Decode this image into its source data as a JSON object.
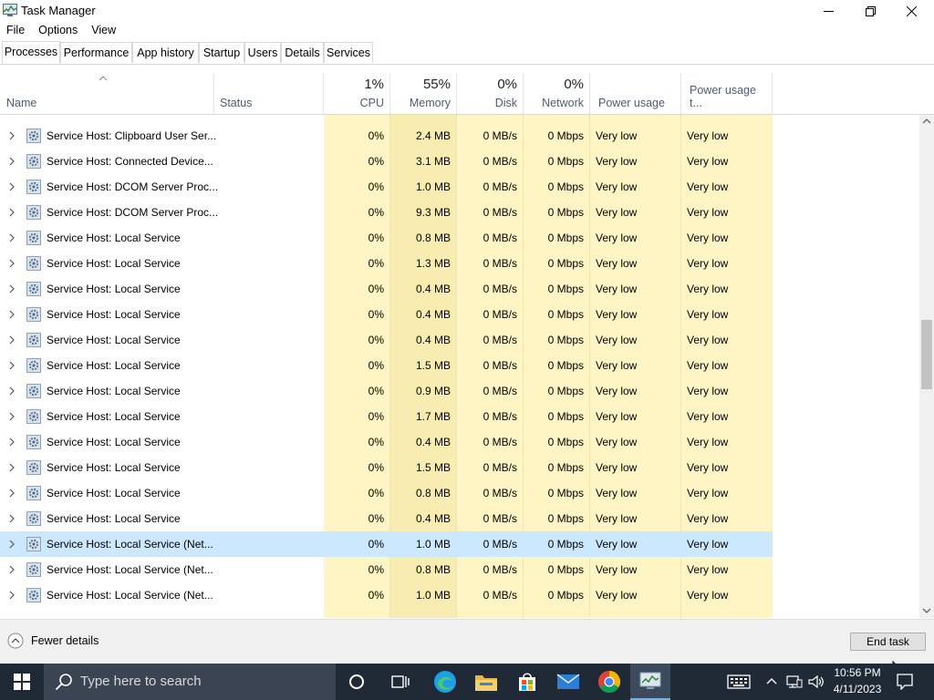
{
  "window": {
    "title": "Task Manager"
  },
  "menu": [
    "File",
    "Options",
    "View"
  ],
  "tabs": [
    "Processes",
    "Performance",
    "App history",
    "Startup",
    "Users",
    "Details",
    "Services"
  ],
  "active_tab": "Processes",
  "columns": {
    "name": {
      "label": "Name"
    },
    "status": {
      "label": "Status"
    },
    "cpu": {
      "pct": "1%",
      "label": "CPU"
    },
    "memory": {
      "pct": "55%",
      "label": "Memory"
    },
    "disk": {
      "pct": "0%",
      "label": "Disk"
    },
    "network": {
      "pct": "0%",
      "label": "Network"
    },
    "power": {
      "label": "Power usage"
    },
    "power_trend": {
      "label": "Power usage t..."
    }
  },
  "rows": [
    {
      "name": "Service Host: Clipboard User Ser...",
      "cpu": "0%",
      "memory": "2.4 MB",
      "disk": "0 MB/s",
      "network": "0 Mbps",
      "power": "Very low",
      "power_trend": "Very low"
    },
    {
      "name": "Service Host: Connected Device...",
      "cpu": "0%",
      "memory": "3.1 MB",
      "disk": "0 MB/s",
      "network": "0 Mbps",
      "power": "Very low",
      "power_trend": "Very low"
    },
    {
      "name": "Service Host: DCOM Server Proc...",
      "cpu": "0%",
      "memory": "1.0 MB",
      "disk": "0 MB/s",
      "network": "0 Mbps",
      "power": "Very low",
      "power_trend": "Very low"
    },
    {
      "name": "Service Host: DCOM Server Proc...",
      "cpu": "0%",
      "memory": "9.3 MB",
      "disk": "0 MB/s",
      "network": "0 Mbps",
      "power": "Very low",
      "power_trend": "Very low"
    },
    {
      "name": "Service Host: Local Service",
      "cpu": "0%",
      "memory": "0.8 MB",
      "disk": "0 MB/s",
      "network": "0 Mbps",
      "power": "Very low",
      "power_trend": "Very low"
    },
    {
      "name": "Service Host: Local Service",
      "cpu": "0%",
      "memory": "1.3 MB",
      "disk": "0 MB/s",
      "network": "0 Mbps",
      "power": "Very low",
      "power_trend": "Very low"
    },
    {
      "name": "Service Host: Local Service",
      "cpu": "0%",
      "memory": "0.4 MB",
      "disk": "0 MB/s",
      "network": "0 Mbps",
      "power": "Very low",
      "power_trend": "Very low"
    },
    {
      "name": "Service Host: Local Service",
      "cpu": "0%",
      "memory": "0.4 MB",
      "disk": "0 MB/s",
      "network": "0 Mbps",
      "power": "Very low",
      "power_trend": "Very low"
    },
    {
      "name": "Service Host: Local Service",
      "cpu": "0%",
      "memory": "0.4 MB",
      "disk": "0 MB/s",
      "network": "0 Mbps",
      "power": "Very low",
      "power_trend": "Very low"
    },
    {
      "name": "Service Host: Local Service",
      "cpu": "0%",
      "memory": "1.5 MB",
      "disk": "0 MB/s",
      "network": "0 Mbps",
      "power": "Very low",
      "power_trend": "Very low"
    },
    {
      "name": "Service Host: Local Service",
      "cpu": "0%",
      "memory": "0.9 MB",
      "disk": "0 MB/s",
      "network": "0 Mbps",
      "power": "Very low",
      "power_trend": "Very low"
    },
    {
      "name": "Service Host: Local Service",
      "cpu": "0%",
      "memory": "1.7 MB",
      "disk": "0 MB/s",
      "network": "0 Mbps",
      "power": "Very low",
      "power_trend": "Very low"
    },
    {
      "name": "Service Host: Local Service",
      "cpu": "0%",
      "memory": "0.4 MB",
      "disk": "0 MB/s",
      "network": "0 Mbps",
      "power": "Very low",
      "power_trend": "Very low"
    },
    {
      "name": "Service Host: Local Service",
      "cpu": "0%",
      "memory": "1.5 MB",
      "disk": "0 MB/s",
      "network": "0 Mbps",
      "power": "Very low",
      "power_trend": "Very low"
    },
    {
      "name": "Service Host: Local Service",
      "cpu": "0%",
      "memory": "0.8 MB",
      "disk": "0 MB/s",
      "network": "0 Mbps",
      "power": "Very low",
      "power_trend": "Very low"
    },
    {
      "name": "Service Host: Local Service",
      "cpu": "0%",
      "memory": "0.4 MB",
      "disk": "0 MB/s",
      "network": "0 Mbps",
      "power": "Very low",
      "power_trend": "Very low"
    },
    {
      "name": "Service Host: Local Service (Net...",
      "cpu": "0%",
      "memory": "1.0 MB",
      "disk": "0 MB/s",
      "network": "0 Mbps",
      "power": "Very low",
      "power_trend": "Very low",
      "selected": true
    },
    {
      "name": "Service Host: Local Service (Net...",
      "cpu": "0%",
      "memory": "0.8 MB",
      "disk": "0 MB/s",
      "network": "0 Mbps",
      "power": "Very low",
      "power_trend": "Very low"
    },
    {
      "name": "Service Host: Local Service (Net...",
      "cpu": "0%",
      "memory": "1.0 MB",
      "disk": "0 MB/s",
      "network": "0 Mbps",
      "power": "Very low",
      "power_trend": "Very low"
    }
  ],
  "footer": {
    "fewer_details": "Fewer details",
    "end_task": "End task"
  },
  "taskbar": {
    "search_placeholder": "Type here to search",
    "time": "10:56 PM",
    "date": "4/11/2023"
  },
  "colors": {
    "cpu_col": "#fff4c4",
    "memory_col": "#f9ecb0",
    "other_col": "#fff4c4",
    "selected_row": "#cce8ff",
    "taskbar": "#1f2a36"
  }
}
